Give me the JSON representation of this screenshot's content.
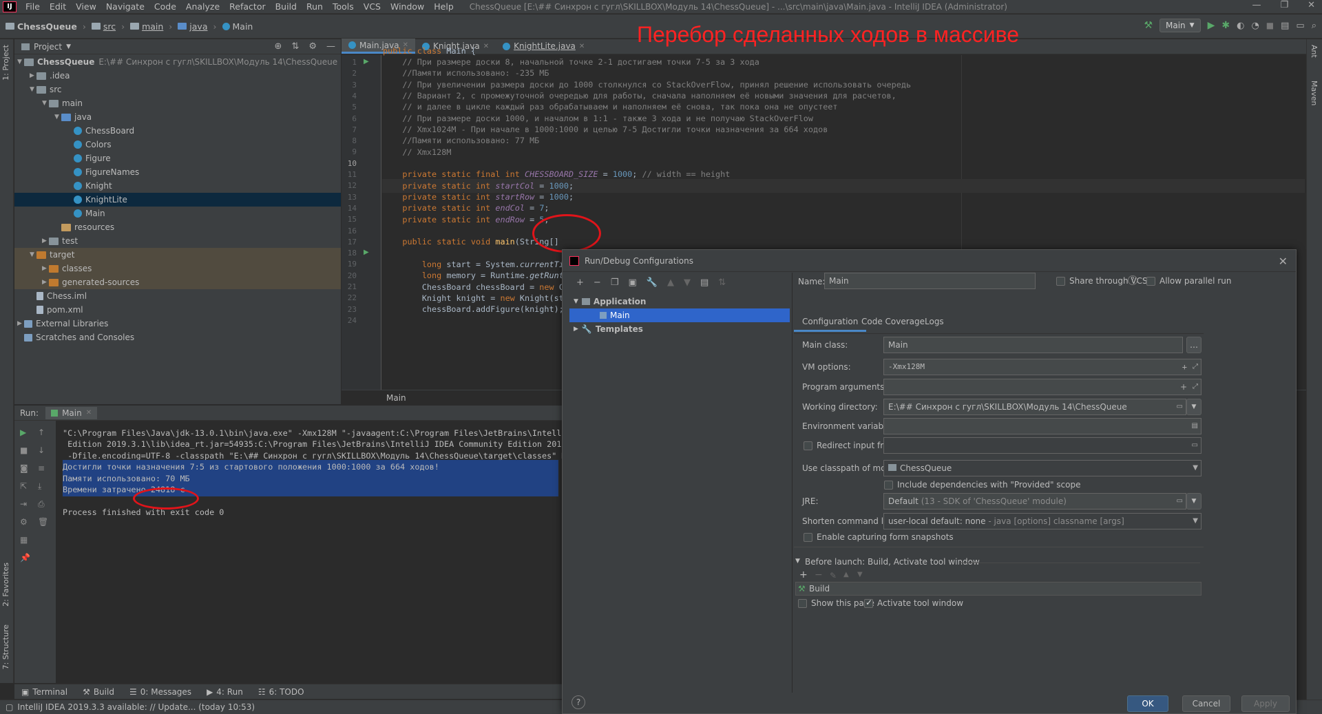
{
  "menu": {
    "items": [
      "File",
      "Edit",
      "View",
      "Navigate",
      "Code",
      "Analyze",
      "Refactor",
      "Build",
      "Run",
      "Tools",
      "VCS",
      "Window",
      "Help"
    ],
    "window_title": "ChessQueue [E:\\## Синхрон с гугл\\SKILLBOX\\Модуль 14\\ChessQueue] - ...\\src\\main\\java\\Main.java - IntelliJ IDEA (Administrator)"
  },
  "nav": {
    "crumbs": [
      "ChessQueue",
      "src",
      "main",
      "java",
      "Main"
    ],
    "run_config": "Main"
  },
  "headline": "Перебор сделанных ходов в массиве",
  "side_tabs": {
    "project": "1: Project",
    "favorites": "2: Favorites",
    "structure": "7: Structure",
    "ant": "Ant",
    "maven": "Maven"
  },
  "project": {
    "title": "Project",
    "tree": [
      {
        "label": "ChessQueue",
        "hint": "E:\\## Синхрон с гугл\\SKILLBOX\\Модуль 14\\ChessQueue",
        "depth": 0,
        "arrow": "▼",
        "icon": "folder"
      },
      {
        "label": ".idea",
        "depth": 1,
        "arrow": "▶",
        "icon": "folder"
      },
      {
        "label": "src",
        "depth": 1,
        "arrow": "▼",
        "icon": "folder"
      },
      {
        "label": "main",
        "depth": 2,
        "arrow": "▼",
        "icon": "folder"
      },
      {
        "label": "java",
        "depth": 3,
        "arrow": "▼",
        "icon": "src"
      },
      {
        "label": "ChessBoard",
        "depth": 4,
        "arrow": "",
        "icon": "class"
      },
      {
        "label": "Colors",
        "depth": 4,
        "arrow": "",
        "icon": "class"
      },
      {
        "label": "Figure",
        "depth": 4,
        "arrow": "",
        "icon": "class"
      },
      {
        "label": "FigureNames",
        "depth": 4,
        "arrow": "",
        "icon": "class"
      },
      {
        "label": "Knight",
        "depth": 4,
        "arrow": "",
        "icon": "class"
      },
      {
        "label": "KnightLite",
        "depth": 4,
        "arrow": "",
        "icon": "class",
        "selected": true
      },
      {
        "label": "Main",
        "depth": 4,
        "arrow": "",
        "icon": "class"
      },
      {
        "label": "resources",
        "depth": 3,
        "arrow": "",
        "icon": "res"
      },
      {
        "label": "test",
        "depth": 2,
        "arrow": "▶",
        "icon": "folder"
      },
      {
        "label": "target",
        "depth": 1,
        "arrow": "▼",
        "icon": "orange",
        "target": true
      },
      {
        "label": "classes",
        "depth": 2,
        "arrow": "▶",
        "icon": "orange",
        "target": true
      },
      {
        "label": "generated-sources",
        "depth": 2,
        "arrow": "▶",
        "icon": "orange",
        "target": true
      },
      {
        "label": "Chess.iml",
        "depth": 1,
        "arrow": "",
        "icon": "file"
      },
      {
        "label": "pom.xml",
        "depth": 1,
        "arrow": "",
        "icon": "file"
      },
      {
        "label": "External Libraries",
        "depth": 0,
        "arrow": "▶",
        "icon": "lib"
      },
      {
        "label": "Scratches and Consoles",
        "depth": 0,
        "arrow": "",
        "icon": "lib"
      }
    ]
  },
  "editor": {
    "tabs": [
      "Main.java",
      "Knight.java",
      "KnightLite.java"
    ],
    "breadcrumb_footer": "Main",
    "current_line": 10
  },
  "run": {
    "label": "Run:",
    "tab": "Main",
    "lines": [
      {
        "text": "\"C:\\Program Files\\Java\\jdk-13.0.1\\bin\\java.exe\" -Xmx128M \"-javaagent:C:\\Program Files\\JetBrains\\Intelli",
        "hl": false
      },
      {
        "text": " Edition 2019.3.1\\lib\\idea_rt.jar=54935:C:\\Program Files\\JetBrains\\IntelliJ IDEA Community Edition 2019",
        "hl": false
      },
      {
        "text": " -Dfile.encoding=UTF-8 -classpath \"E:\\## Синхрон с гугл\\SKILLBOX\\Модуль 14\\ChessQueue\\target\\classes\" M",
        "hl": false
      },
      {
        "text": "Достигли точки назначения 7:5 из стартового положения 1000:1000 за 664 ходов!",
        "hl": true
      },
      {
        "text": "Памяти использовано: 70 МБ",
        "hl": true
      },
      {
        "text": "Времени затрачено 24818 с",
        "hl": true
      },
      {
        "text": "",
        "hl": false
      },
      {
        "text": "Process finished with exit code 0",
        "hl": false
      }
    ]
  },
  "bottom_tabs": [
    "Terminal",
    "Build",
    "0: Messages",
    "4: Run",
    "6: TODO"
  ],
  "status": "IntelliJ IDEA 2019.3.3 available: // Update... (today 10:53)",
  "dialog": {
    "title": "Run/Debug Configurations",
    "tree": {
      "group": "Application",
      "item": "Main",
      "templates": "Templates"
    },
    "name_label": "Name:",
    "name_value": "Main",
    "share_vcs": "Share through VCS",
    "allow_parallel": "Allow parallel run",
    "tabs": [
      "Configuration",
      "Code Coverage",
      "Logs"
    ],
    "fields": {
      "main_class_label": "Main class:",
      "main_class": "Main",
      "vm_label": "VM options:",
      "vm": "-Xmx128M",
      "args_label": "Program arguments:",
      "args": "",
      "wd_label": "Working directory:",
      "wd": "E:\\## Синхрон с гугл\\SKILLBOX\\Модуль 14\\ChessQueue",
      "env_label": "Environment variables:",
      "env": "",
      "redirect_label": "Redirect input from:",
      "classpath_label": "Use classpath of module:",
      "classpath": "ChessQueue",
      "include_deps": "Include dependencies with \"Provided\" scope",
      "jre_label": "JRE:",
      "jre": "Default",
      "jre_hint": "(13 - SDK of 'ChessQueue' module)",
      "shorten_label": "Shorten command line:",
      "shorten": "user-local default: none",
      "shorten_hint": " - java [options] classname [args]",
      "snapshots": "Enable capturing form snapshots"
    },
    "before_launch": "Before launch: Build, Activate tool window",
    "build_item": "Build",
    "show_page": "Show this page",
    "activate_tool": "Activate tool window",
    "buttons": {
      "ok": "OK",
      "cancel": "Cancel",
      "apply": "Apply",
      "help": "?"
    }
  },
  "colors": {
    "accent": "#4a88c7",
    "annotation": "#e0141a",
    "selection": "#2f65ca"
  }
}
